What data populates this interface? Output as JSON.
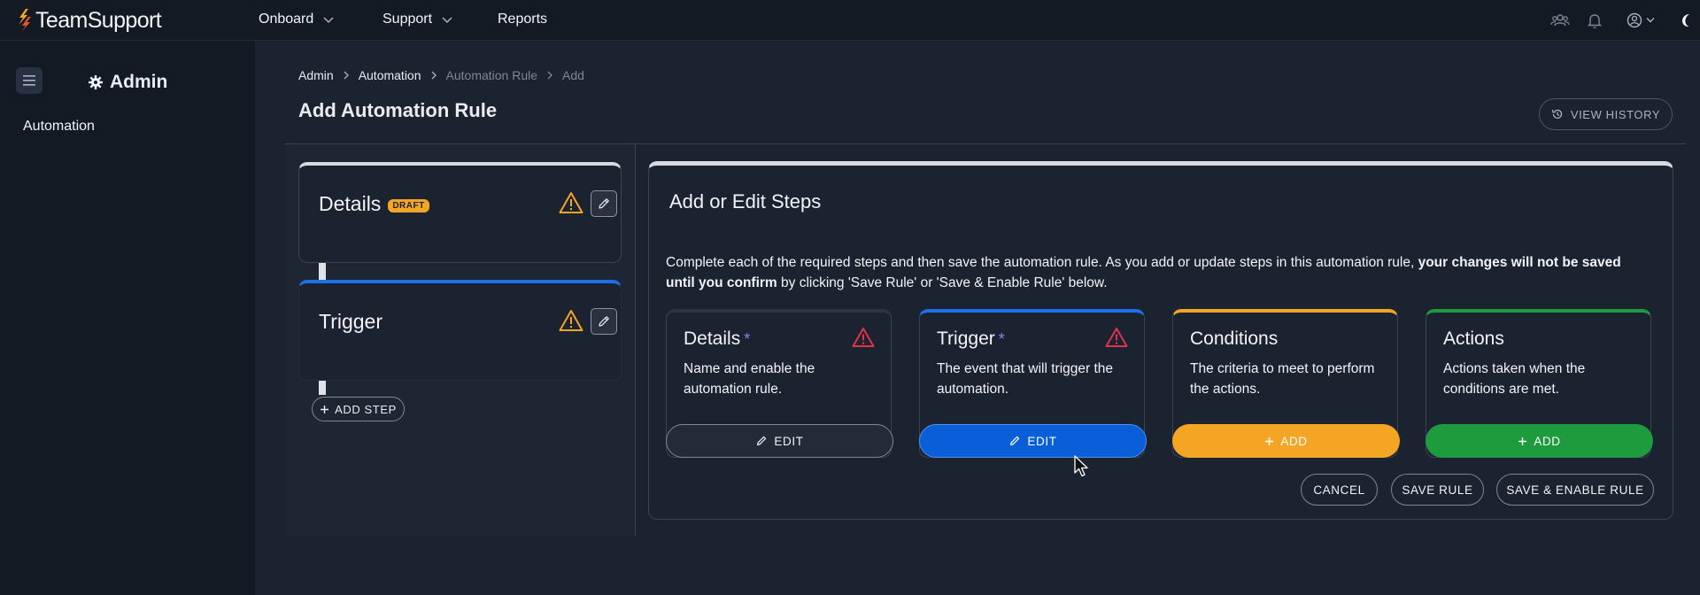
{
  "brand": {
    "name": "TeamSupport"
  },
  "topnav": {
    "items": [
      {
        "label": "Onboard",
        "has_dropdown": true
      },
      {
        "label": "Support",
        "has_dropdown": true
      },
      {
        "label": "Reports",
        "has_dropdown": false
      }
    ],
    "right_icons": [
      "people-icon",
      "bell-icon",
      "user-circle-icon",
      "moon-icon"
    ]
  },
  "sidebar": {
    "title": "Admin",
    "title_icon": "gear-icon",
    "items": [
      {
        "label": "Automation"
      }
    ]
  },
  "breadcrumb": [
    {
      "label": "Admin",
      "active": true
    },
    {
      "label": "Automation",
      "active": true
    },
    {
      "label": "Automation Rule",
      "active": false
    },
    {
      "label": "Add",
      "active": false
    }
  ],
  "page": {
    "title": "Add Automation Rule",
    "view_history_label": "VIEW HISTORY"
  },
  "steps": {
    "details": {
      "title": "Details",
      "badge": "DRAFT"
    },
    "trigger": {
      "title": "Trigger"
    },
    "add_step_label": "ADD STEP"
  },
  "editor": {
    "title": "Add or Edit Steps",
    "desc_part1": "Complete each of the required steps and then save the automation rule. As you add or update steps in this automation rule, ",
    "desc_bold": "your changes will not be saved until you confirm",
    "desc_part2": " by clicking 'Save Rule' or 'Save & Enable Rule' below.",
    "cards": [
      {
        "title": "Details",
        "required": "*",
        "description": "Name and enable the automation rule.",
        "button": "EDIT",
        "color": "#d6dbe2"
      },
      {
        "title": "Trigger",
        "required": "*",
        "description": "The event that will trigger the automation.",
        "button": "EDIT",
        "color": "#1f6feb"
      },
      {
        "title": "Conditions",
        "description": "The criteria to meet to perform the actions.",
        "button": "ADD",
        "color": "#f5a524"
      },
      {
        "title": "Actions",
        "description": "Actions taken when the conditions are met.",
        "button": "ADD",
        "color": "#1e9b3d"
      }
    ],
    "footer": {
      "cancel": "CANCEL",
      "save": "SAVE RULE",
      "save_enable": "SAVE & ENABLE RULE"
    }
  },
  "colors": {
    "background": "#1b2230",
    "nav": "#141a24",
    "blue": "#0a5fd8",
    "yellow": "#f5a524",
    "green": "#1e9b3d",
    "warning_amber": "#f5a524",
    "warning_red": "#e0334a"
  }
}
